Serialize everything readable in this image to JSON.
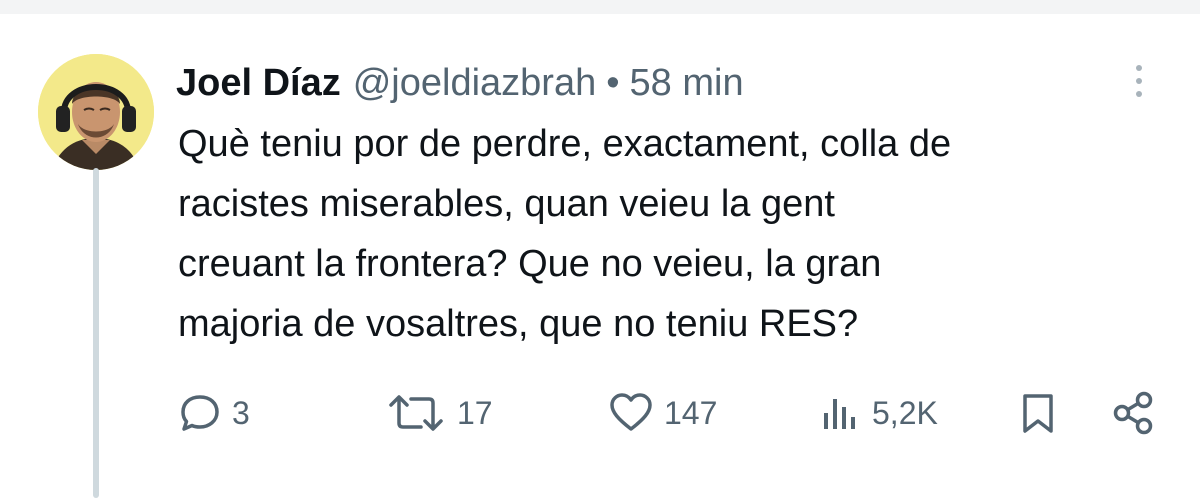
{
  "tweet": {
    "author_name": "Joel Díaz",
    "handle": "@joeldiazbrah",
    "separator": "•",
    "time": "58 min",
    "text": "Què teniu por de perdre, exactament, colla de\nracistes miserables, quan veieu la gent\ncreuant la frontera? Que no veieu, la gran\nmajoria de vosaltres, que no teniu RES?"
  },
  "actions": {
    "replies": "3",
    "reposts": "17",
    "likes": "147",
    "views": "5,2K"
  },
  "icons": {
    "reply": "reply-icon",
    "repost": "repost-icon",
    "like": "heart-icon",
    "views": "views-icon",
    "bookmark": "bookmark-icon",
    "share": "share-icon",
    "more": "more-icon"
  },
  "colors": {
    "text": "#0f1419",
    "secondary": "#536471",
    "avatar_bg": "#f3e98a",
    "thread_line": "#cfd9de"
  }
}
